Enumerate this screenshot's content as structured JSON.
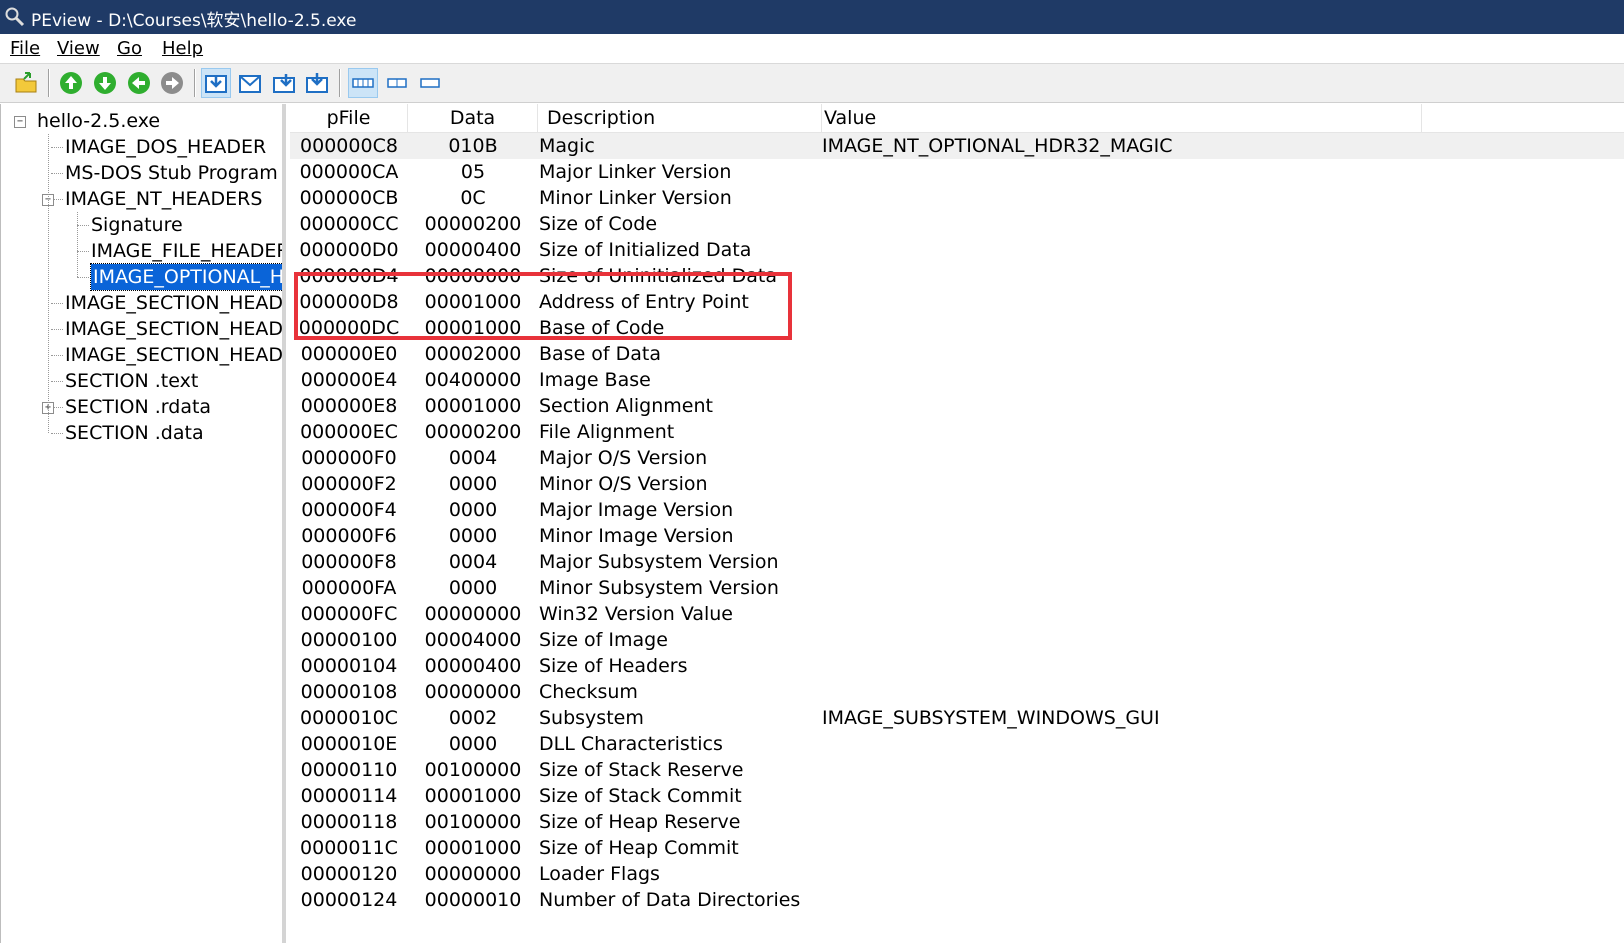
{
  "window": {
    "title": "PEview - D:\\Courses\\软安\\hello-2.5.exe"
  },
  "menu": [
    "File",
    "View",
    "Go",
    "Help"
  ],
  "toolbar_icons": [
    "open-folder-icon",
    "nav-up-icon",
    "nav-down-icon",
    "nav-back-icon",
    "nav-forward-icon",
    "view-byte-icon",
    "view-word-icon",
    "view-dword-icon",
    "view-details-icon",
    "layout-wide-icon",
    "layout-medium-icon",
    "layout-narrow-icon"
  ],
  "tree": [
    {
      "label": "hello-2.5.exe",
      "level": 0,
      "expander": "−"
    },
    {
      "label": "IMAGE_DOS_HEADER",
      "level": 1
    },
    {
      "label": "MS-DOS Stub Program",
      "level": 1
    },
    {
      "label": "IMAGE_NT_HEADERS",
      "level": 1,
      "expander": "−"
    },
    {
      "label": "Signature",
      "level": 2
    },
    {
      "label": "IMAGE_FILE_HEADER",
      "level": 2
    },
    {
      "label": "IMAGE_OPTIONAL_HEADER",
      "level": 2,
      "selected": true
    },
    {
      "label": "IMAGE_SECTION_HEADER .text",
      "level": 1
    },
    {
      "label": "IMAGE_SECTION_HEADER .rdata",
      "level": 1
    },
    {
      "label": "IMAGE_SECTION_HEADER .data",
      "level": 1
    },
    {
      "label": "SECTION .text",
      "level": 1
    },
    {
      "label": "SECTION .rdata",
      "level": 1,
      "expander": "+"
    },
    {
      "label": "SECTION .data",
      "level": 1
    }
  ],
  "table": {
    "columns": [
      "pFile",
      "Data",
      "Description",
      "Value"
    ],
    "rows": [
      [
        "000000C8",
        "010B",
        "Magic",
        "IMAGE_NT_OPTIONAL_HDR32_MAGIC"
      ],
      [
        "000000CA",
        "05",
        "Major Linker Version",
        ""
      ],
      [
        "000000CB",
        "0C",
        "Minor Linker Version",
        ""
      ],
      [
        "000000CC",
        "00000200",
        "Size of Code",
        ""
      ],
      [
        "000000D0",
        "00000400",
        "Size of Initialized Data",
        ""
      ],
      [
        "000000D4",
        "00000000",
        "Size of Uninitialized Data",
        ""
      ],
      [
        "000000D8",
        "00001000",
        "Address of Entry Point",
        ""
      ],
      [
        "000000DC",
        "00001000",
        "Base of Code",
        ""
      ],
      [
        "000000E0",
        "00002000",
        "Base of Data",
        ""
      ],
      [
        "000000E4",
        "00400000",
        "Image Base",
        ""
      ],
      [
        "000000E8",
        "00001000",
        "Section Alignment",
        ""
      ],
      [
        "000000EC",
        "00000200",
        "File Alignment",
        ""
      ],
      [
        "000000F0",
        "0004",
        "Major O/S Version",
        ""
      ],
      [
        "000000F2",
        "0000",
        "Minor O/S Version",
        ""
      ],
      [
        "000000F4",
        "0000",
        "Major Image Version",
        ""
      ],
      [
        "000000F6",
        "0000",
        "Minor Image Version",
        ""
      ],
      [
        "000000F8",
        "0004",
        "Major Subsystem Version",
        ""
      ],
      [
        "000000FA",
        "0000",
        "Minor Subsystem Version",
        ""
      ],
      [
        "000000FC",
        "00000000",
        "Win32 Version Value",
        ""
      ],
      [
        "00000100",
        "00004000",
        "Size of Image",
        ""
      ],
      [
        "00000104",
        "00000400",
        "Size of Headers",
        ""
      ],
      [
        "00000108",
        "00000000",
        "Checksum",
        ""
      ],
      [
        "0000010C",
        "0002",
        "Subsystem",
        "IMAGE_SUBSYSTEM_WINDOWS_GUI"
      ],
      [
        "0000010E",
        "0000",
        "DLL Characteristics",
        ""
      ],
      [
        "00000110",
        "00100000",
        "Size of Stack Reserve",
        ""
      ],
      [
        "00000114",
        "00001000",
        "Size of Stack Commit",
        ""
      ],
      [
        "00000118",
        "00100000",
        "Size of Heap Reserve",
        ""
      ],
      [
        "0000011C",
        "00001000",
        "Size of Heap Commit",
        ""
      ],
      [
        "00000120",
        "00000000",
        "Loader Flags",
        ""
      ],
      [
        "00000124",
        "00000010",
        "Number of Data Directories",
        ""
      ]
    ]
  },
  "colors": {
    "titlebar": "#1f3a66",
    "selection": "#0a64d8",
    "highlight_box": "#e8323a"
  }
}
